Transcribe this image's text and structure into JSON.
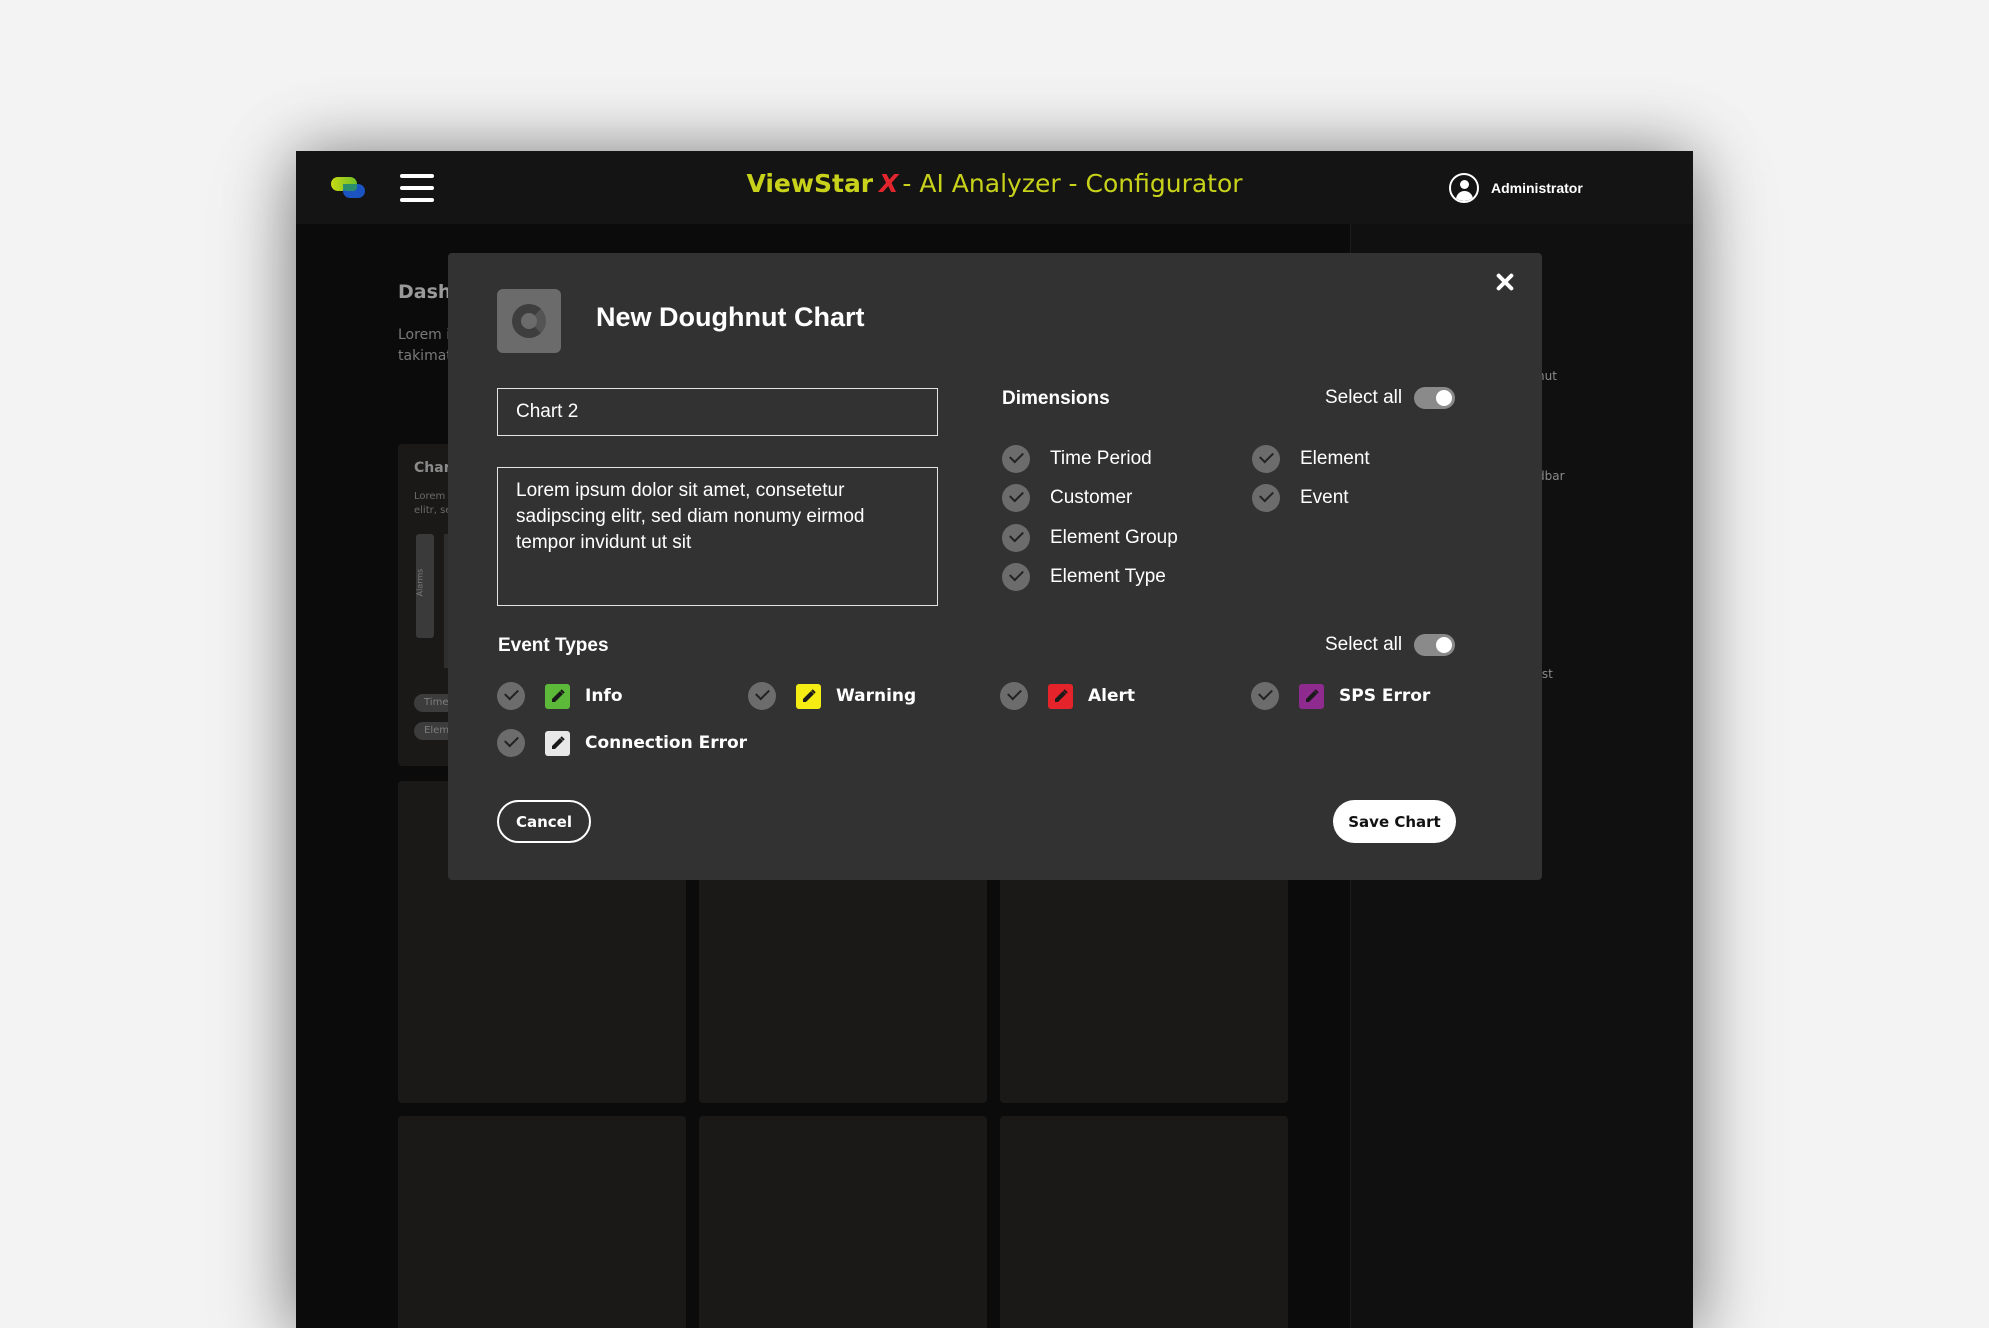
{
  "app": {
    "brand": "ViewStar",
    "brand_x": "X",
    "subtitle": "- AI Analyzer - Configurator",
    "user_name": "Administrator"
  },
  "background": {
    "page_title": "Dashb",
    "page_text": "Lorem i aliquya takimat",
    "card_title": "Char",
    "card_text": "Lorem elitr, se",
    "axis_label": "Alarms",
    "chip_1": "Time",
    "chip_2": "Elem",
    "side_labels": [
      "nut",
      "dbar",
      "rst"
    ]
  },
  "dialog": {
    "title": "New Doughnut Chart",
    "name_value": "Chart 2",
    "description_value": "Lorem ipsum dolor sit amet, consetetur sadipscing elitr, sed diam nonumy eirmod tempor invidunt ut sit",
    "dimensions_title": "Dimensions",
    "dimensions_select_all": "Select all",
    "dimensions": [
      "Time Period",
      "Customer",
      "Element Group",
      "Element Type",
      "Element",
      "Event"
    ],
    "event_types_title": "Event Types",
    "event_types_select_all": "Select all",
    "event_types": [
      {
        "label": "Info",
        "color": "#5db93a"
      },
      {
        "label": "Warning",
        "color": "#f4ec13"
      },
      {
        "label": "Alert",
        "color": "#e4232b"
      },
      {
        "label": "SPS Error",
        "color": "#8f2a8f"
      },
      {
        "label": "Connection Error",
        "color": "#e8e8e8"
      }
    ],
    "cancel_label": "Cancel",
    "save_label": "Save Chart"
  },
  "icons": {
    "close": "close-icon",
    "chart": "doughnut-chart-icon",
    "edit": "pencil-icon",
    "check": "check-icon",
    "menu": "hamburger-icon",
    "user": "user-icon"
  }
}
